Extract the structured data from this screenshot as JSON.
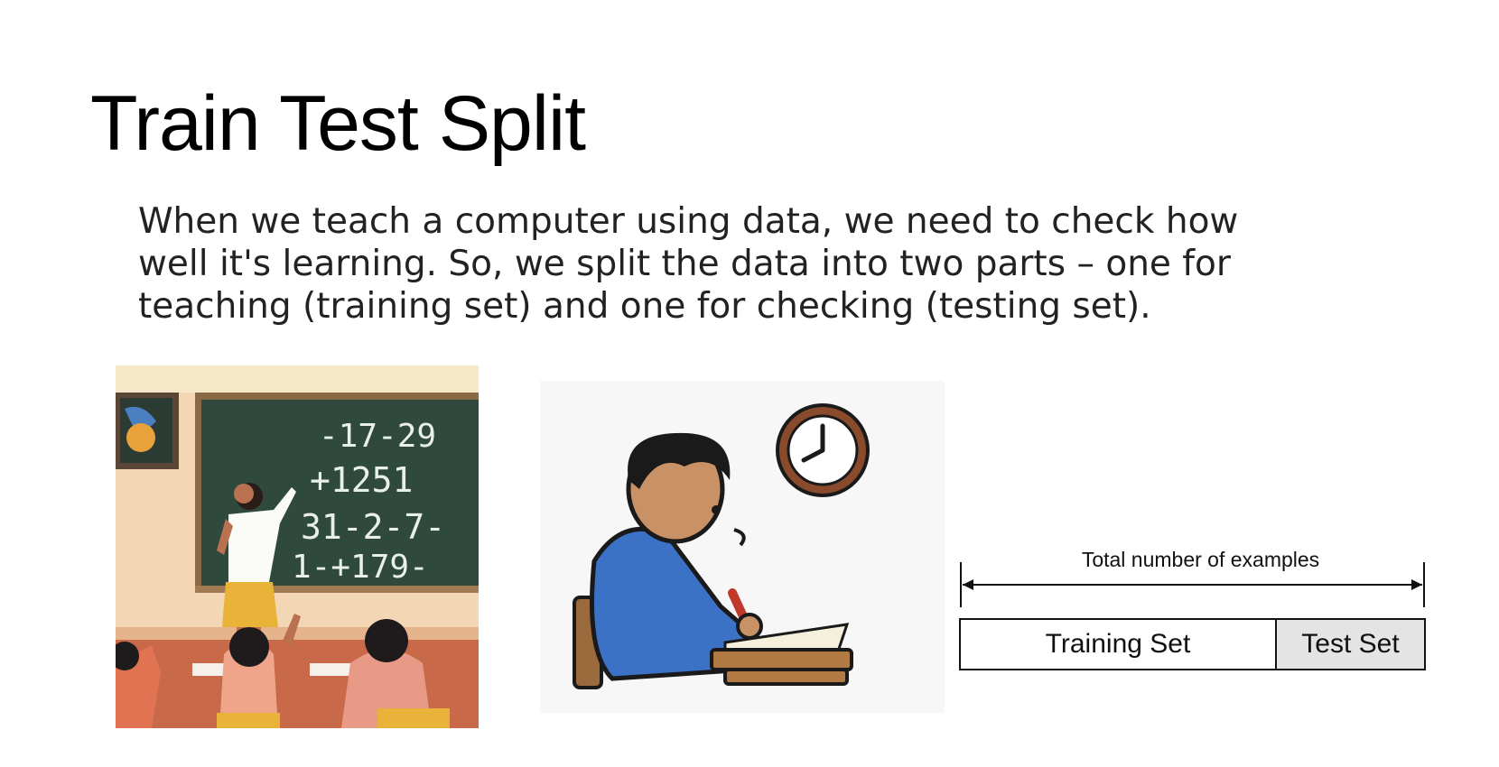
{
  "slide": {
    "title": "Train Test Split",
    "body_lines": [
      "When we teach a computer using data, we need to check how",
      "well it's learning. So, we split the data into two parts – one for",
      "teaching (training set) and one for checking (testing set)."
    ]
  },
  "images": {
    "teacher": {
      "board_text_lines": [
        "-17-29",
        "+1251",
        "31-2-7-",
        "1-+179-"
      ]
    },
    "student": {}
  },
  "diagram": {
    "total_label": "Total number of examples",
    "training_label": "Training Set",
    "test_label": "Test Set",
    "training_fraction": 0.68,
    "colors": {
      "training": "#ffffff",
      "test": "#e4e4e4"
    }
  }
}
